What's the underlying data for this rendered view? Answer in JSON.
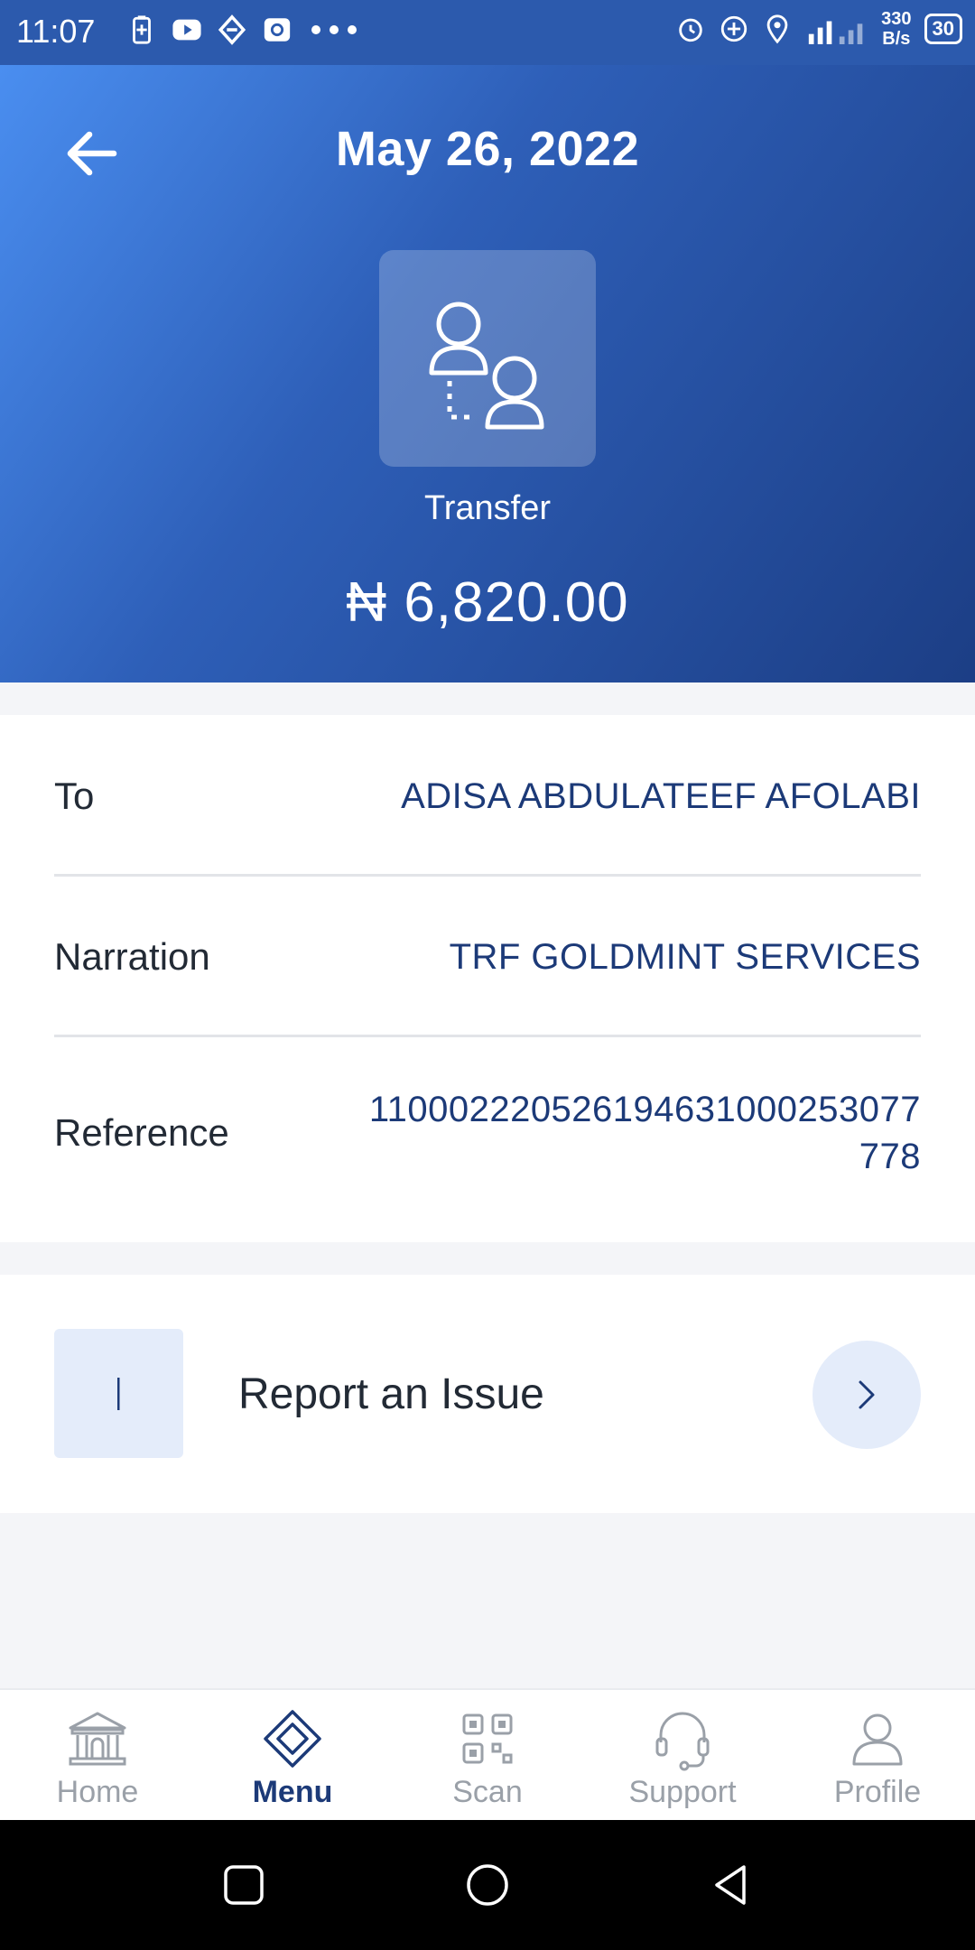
{
  "status_bar": {
    "time": "11:07",
    "net_speed_value": "330",
    "net_speed_unit": "B/s",
    "network": "4G",
    "battery": "30"
  },
  "header": {
    "date": "May 26, 2022",
    "transaction_type": "Transfer",
    "amount": "₦ 6,820.00",
    "gradient_colors": [
      "#4a8ef0",
      "#1c3e85"
    ]
  },
  "details": {
    "to": {
      "label": "To",
      "value": "ADISA ABDULATEEF AFOLABI"
    },
    "narration": {
      "label": "Narration",
      "value": "TRF GOLDMINT SERVICES"
    },
    "reference": {
      "label": "Reference",
      "value_line1": "110002220526194631000253077",
      "value_line2": "778"
    }
  },
  "report": {
    "label": "Report an Issue",
    "icon": "info-icon"
  },
  "bottom_nav": {
    "items": [
      {
        "label": "Home",
        "icon": "bank-icon"
      },
      {
        "label": "Menu",
        "icon": "diamond-icon"
      },
      {
        "label": "Scan",
        "icon": "qr-icon"
      },
      {
        "label": "Support",
        "icon": "headset-icon"
      },
      {
        "label": "Profile",
        "icon": "user-icon"
      }
    ],
    "active": "Menu"
  },
  "colors": {
    "accent": "#1c3a78",
    "muted": "#9aa0a8",
    "soft_blue": "#e4ecfa"
  }
}
